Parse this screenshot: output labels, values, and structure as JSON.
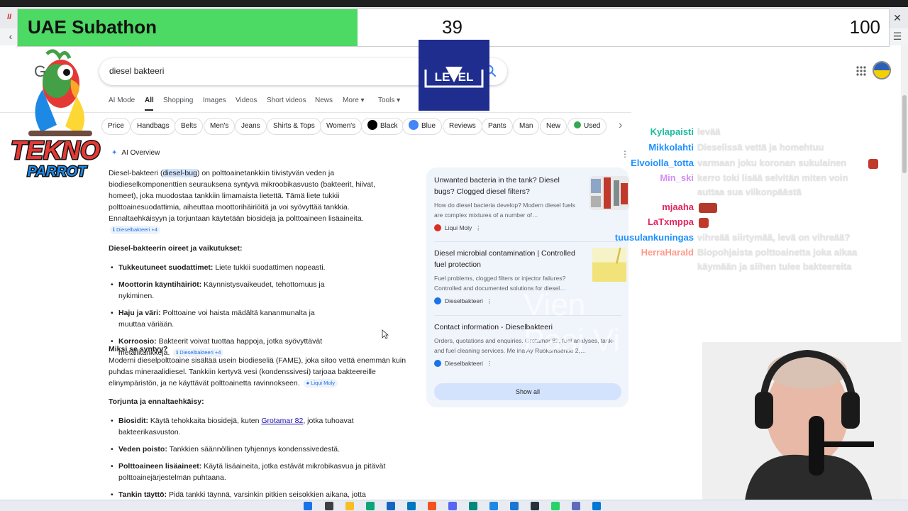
{
  "browser": {
    "back_icon": "arrow-left-icon",
    "close_icon": "close-icon",
    "menu_icon": "menu-icon",
    "tab_logo_text": "II"
  },
  "subathon": {
    "title": "UAE Subathon",
    "current": "39",
    "goal": "100",
    "progress_fraction": 0.39,
    "fill_color": "#4cd964"
  },
  "overlay": {
    "parrot_text_1": "TEKNO",
    "parrot_text_2": "PARROT",
    "level_logo_text": "LEVEL",
    "watermark_line_1": "Vien",
    "watermark_line_2": "Pasi Vi"
  },
  "search": {
    "query": "diesel bakteeri",
    "logo_letter": "G"
  },
  "tabs": [
    {
      "label": "AI Mode"
    },
    {
      "label": "All"
    },
    {
      "label": "Shopping"
    },
    {
      "label": "Images"
    },
    {
      "label": "Videos"
    },
    {
      "label": "Short videos"
    },
    {
      "label": "News"
    },
    {
      "label": "More ▾"
    },
    {
      "label": "Tools ▾"
    }
  ],
  "active_tab": "All",
  "chips": [
    {
      "label": "Price"
    },
    {
      "label": "Handbags"
    },
    {
      "label": "Belts"
    },
    {
      "label": "Men's"
    },
    {
      "label": "Jeans"
    },
    {
      "label": "Shirts & Tops"
    },
    {
      "label": "Women's"
    },
    {
      "label": "Black",
      "dot": "#000000"
    },
    {
      "label": "Blue",
      "dot": "#4285f4"
    },
    {
      "label": "Reviews"
    },
    {
      "label": "Pants"
    },
    {
      "label": "Man"
    },
    {
      "label": "New"
    },
    {
      "label": "Used",
      "dot": "#34a853"
    }
  ],
  "ai_overview": {
    "label": "AI Overview",
    "intro_1": "Diesel-bakteeri (",
    "intro_hl": "diesel-bug",
    "intro_2": ") on polttoainetankkiin tiivistyvän veden ja biodieselkomponenttien seurauksena syntyvä mikroobikasvusto (bakteerit, hiivat, homeet), joka muodostaa tankkiin limamaista lietettä. Tämä liete tukkii polttoainesuodattimia, aiheuttaa moottorihäiriöitä ja voi syövyttää tankkia. Ennaltaehkäisyyn ja torjuntaan käytetään biosidejä ja polttoaineen lisäaineita.",
    "intro_cite": "Dieselbakteeri +4",
    "h_symptoms": "Diesel-bakteerin oireet ja vaikutukset:",
    "symptoms": [
      {
        "term": "Tukkeutuneet suodattimet:",
        "text": " Liete tukkii suodattimen nopeasti.",
        "cite": ""
      },
      {
        "term": "Moottorin käyntihäiriöt:",
        "text": " Käynnistysvaikeudet, tehottomuus ja nykiminen.",
        "cite": ""
      },
      {
        "term": "Haju ja väri:",
        "text": " Polttoaine voi haista mädältä kananmunalta ja muuttaa väriään.",
        "cite": ""
      },
      {
        "term": "Korroosio:",
        "text": " Bakteerit voivat tuottaa happoja, jotka syövyttävät metallitankkeja.",
        "cite": "Dieselbakteeri +4"
      }
    ],
    "h_why": "Miksi se syntyy?",
    "why_text": "Moderni dieselpolttoaine sisältää usein biodieseliä (FAME), joka sitoo vettä enemmän kuin puhdas mineraalidiesel. Tankkiin kertyvä vesi (kondenssivesi) tarjoaa bakteereille elinympäristön, ja ne käyttävät polttoainetta ravinnokseen.",
    "why_cite": "Liqui Moly",
    "h_prevent": "Torjunta ja ennaltaehkäisy:",
    "prevent": [
      {
        "term": "Biosidit:",
        "text_1": " Käytä tehokkaita biosidejä, kuten ",
        "link": "Grotamar 82",
        "text_2": ", jotka tuhoavat bakteerikasvuston."
      },
      {
        "term": "Veden poisto:",
        "text_1": " Tankkien säännöllinen tyhjennys kondenssivedestä.",
        "link": "",
        "text_2": ""
      },
      {
        "term": "Polttoaineen lisäaineet:",
        "text_1": " Käytä lisäaineita, jotka estävät mikrobikasvua ja pitävät polttoainejärjestelmän puhtaana.",
        "link": "",
        "text_2": ""
      },
      {
        "term": "Tankin täyttö:",
        "text_1": " Pidä tankki täynnä, varsinkin pitkien seisokkien aikana, jotta",
        "link": "",
        "text_2": ""
      }
    ]
  },
  "sources": [
    {
      "title": "Unwanted bacteria in the tank? Diesel bugs? Clogged diesel filters?",
      "desc": "How do diesel bacteria develop? Modern diesel fuels are complex mixtures of a number of…",
      "site": "Liqui Moly",
      "fav_color": "#d93025"
    },
    {
      "title": "Diesel microbial contamination | Controlled fuel protection",
      "desc": "Fuel problems, clogged filters or injector failures? Controlled and documented solutions for diesel…",
      "site": "Dieselbakteeri",
      "fav_color": "#1a73e8"
    },
    {
      "title": "Contact information - Dieselbakteeri",
      "desc": "Orders, quotations and enquiries. Grotamar 82, fuel analyses, tank- and fuel cleaning services. Me ina Ay Ruoksmäentie 2,…",
      "site": "Dieselbakteeri",
      "fav_color": "#1a73e8"
    }
  ],
  "show_all": "Show all",
  "chat": [
    {
      "user": "Kylapaisti",
      "msg": "levää",
      "color": "#1abc9c"
    },
    {
      "user": "Mikkolahti",
      "msg": "Dieselissä vettä ja homehtuu",
      "color": "#1e90ff"
    },
    {
      "user": "Elvoiolla_totta",
      "msg": "varmaan joku koronan sukulainen",
      "color": "#1e90ff",
      "emote": true
    },
    {
      "user": "Min_ski",
      "msg": "kerro toki lisää selvitän miten voin",
      "color": "#d38ef5"
    },
    {
      "user": "",
      "msg": "auttaa sua viikonpäästä",
      "color": "#d38ef5"
    },
    {
      "user": "mjaaha",
      "msg": "",
      "color": "#e0245e",
      "emote": true
    },
    {
      "user": "LaTxmppa",
      "msg": "",
      "color": "#e0245e",
      "emote": true
    },
    {
      "user": "tuusulankuningas",
      "msg": "vihreää siirtymää, levä on vihreää?",
      "color": "#1e90ff"
    },
    {
      "user": "HerraHarald",
      "msg": "Biopohjaista polttoainetta joka alkaa",
      "color": "#ff9a8a"
    },
    {
      "user": "",
      "msg": "käymään ja siihen tulee bakteereita",
      "color": "#ff9a8a"
    }
  ]
}
